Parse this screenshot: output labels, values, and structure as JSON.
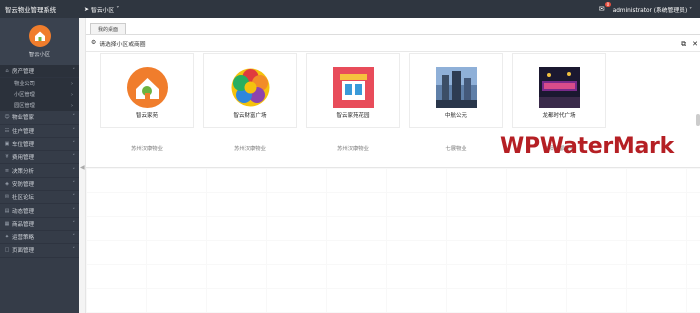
{
  "header": {
    "brand": "智云物业管理系统",
    "community_switch": "智云小区",
    "notifications_count": "0",
    "user": "administrator (系统管理员)"
  },
  "sidebar": {
    "profile_label": "智云小区",
    "groups": [
      {
        "label": "房产管理",
        "icon": "home-icon",
        "open": true,
        "children": [
          "物业公司",
          "小区管理",
          "园区管理"
        ]
      },
      {
        "label": "物业管家",
        "icon": "user-icon"
      },
      {
        "label": "住户管理",
        "icon": "users-icon"
      },
      {
        "label": "车位管理",
        "icon": "car-icon"
      },
      {
        "label": "费用管理",
        "icon": "money-icon"
      },
      {
        "label": "决策分析",
        "icon": "chart-icon"
      },
      {
        "label": "安防管理",
        "icon": "shield-icon"
      },
      {
        "label": "社区论坛",
        "icon": "forum-icon"
      },
      {
        "label": "动态管理",
        "icon": "news-icon"
      },
      {
        "label": "商品管理",
        "icon": "goods-icon"
      },
      {
        "label": "运营策略",
        "icon": "strategy-icon"
      },
      {
        "label": "页面管理",
        "icon": "page-icon"
      }
    ]
  },
  "tabs": [
    "我的桌面"
  ],
  "panel": {
    "title": "请选择小区或商圈"
  },
  "cards": [
    {
      "name": "智云家苑",
      "company": "苏州汉康物业",
      "logo": "house-logo-icon"
    },
    {
      "name": "智云财富广场",
      "company": "苏州汉康物业",
      "logo": "flower-logo-icon"
    },
    {
      "name": "智云家苑花园",
      "company": "苏州汉康物业",
      "logo": "shop-logo-icon"
    },
    {
      "name": "中航公元",
      "company": "七展物业",
      "logo": "building-photo-icon"
    },
    {
      "name": "龙都时代广场",
      "company": "南阳龙都物业",
      "logo": "plaza-photo-icon"
    }
  ],
  "watermark": "WPWaterMark",
  "colors": {
    "topbar": "#2f3640",
    "sidebar": "#353c48",
    "accent_orange": "#f07d2c",
    "watermark": "#b51f24"
  }
}
